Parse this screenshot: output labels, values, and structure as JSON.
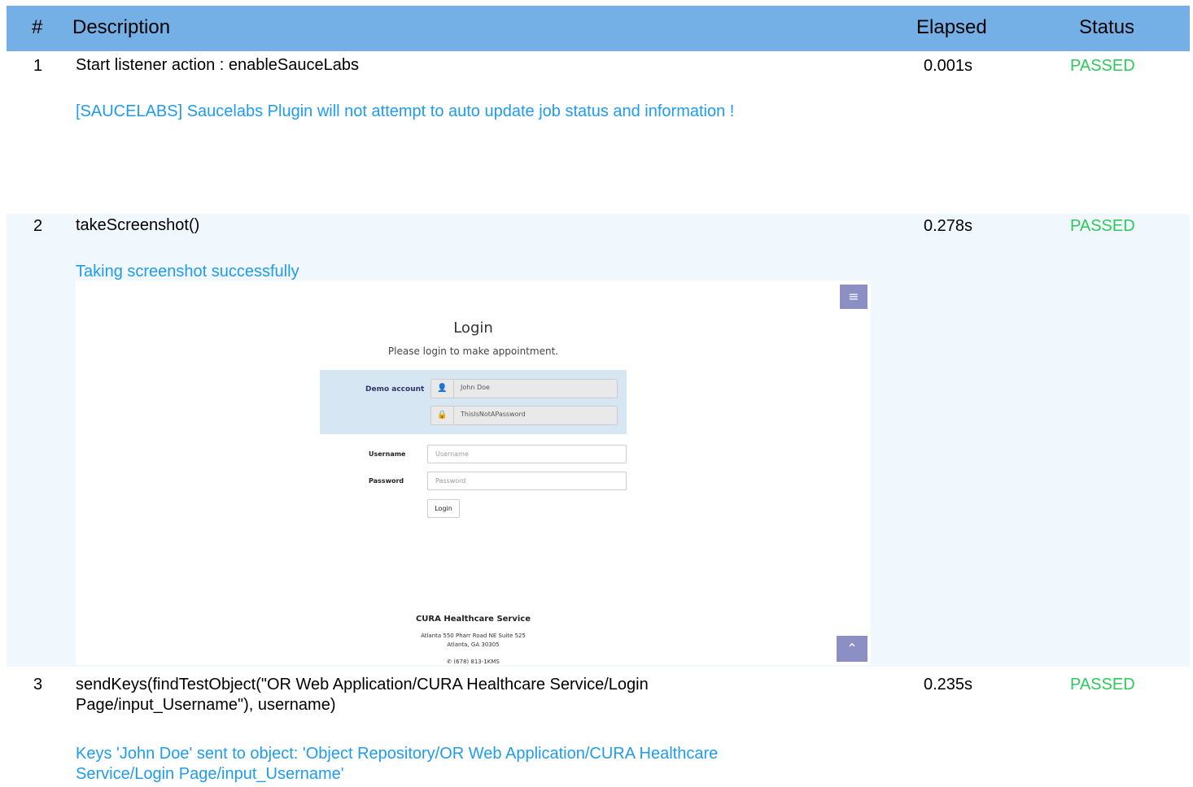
{
  "table_header": {
    "num": "#",
    "description": "Description",
    "elapsed": "Elapsed",
    "status": "Status"
  },
  "steps": [
    {
      "num": "1",
      "description": "Start listener action : enableSauceLabs",
      "elapsed": "0.001s",
      "status": "PASSED",
      "log": "[SAUCELABS] Saucelabs Plugin will not attempt to auto update job status and information !"
    },
    {
      "num": "2",
      "description": "takeScreenshot()",
      "elapsed": "0.278s",
      "status": "PASSED",
      "log": "Taking screenshot successfully"
    },
    {
      "num": "3",
      "description_line1": "sendKeys(findTestObject(\"OR Web Application/CURA Healthcare Service/Login",
      "description_line2": "Page/input_Username\"), username)",
      "elapsed": "0.235s",
      "status": "PASSED",
      "log_line1": "Keys 'John Doe' sent to object: 'Object Repository/OR Web Application/CURA Healthcare",
      "log_line2": "Service/Login Page/input_Username'"
    }
  ],
  "screenshot": {
    "title": "Login",
    "subtitle": "Please login to make appointment.",
    "demo_label": "Demo account",
    "demo_username": "John Doe",
    "demo_password": "ThisIsNotAPassword",
    "username_label": "Username",
    "username_placeholder": "Username",
    "password_label": "Password",
    "password_placeholder": "Password",
    "login_button": "Login",
    "footer_title": "CURA Healthcare Service",
    "footer_address1": "Atlanta 550 Pharr Road NE Suite 525",
    "footer_address2": "Atlanta, GA 30305",
    "footer_phone": "(678) 813-1KMS",
    "menu_icon": "bars-icon",
    "scroll_icon": "chevron-up-icon"
  },
  "colors": {
    "header_bg": "#74b0e5",
    "passed": "#2ec95c",
    "log_text": "#1f9bef",
    "alt_row_bg": "#f0f7fd",
    "button_bg": "#8b8fc3"
  }
}
